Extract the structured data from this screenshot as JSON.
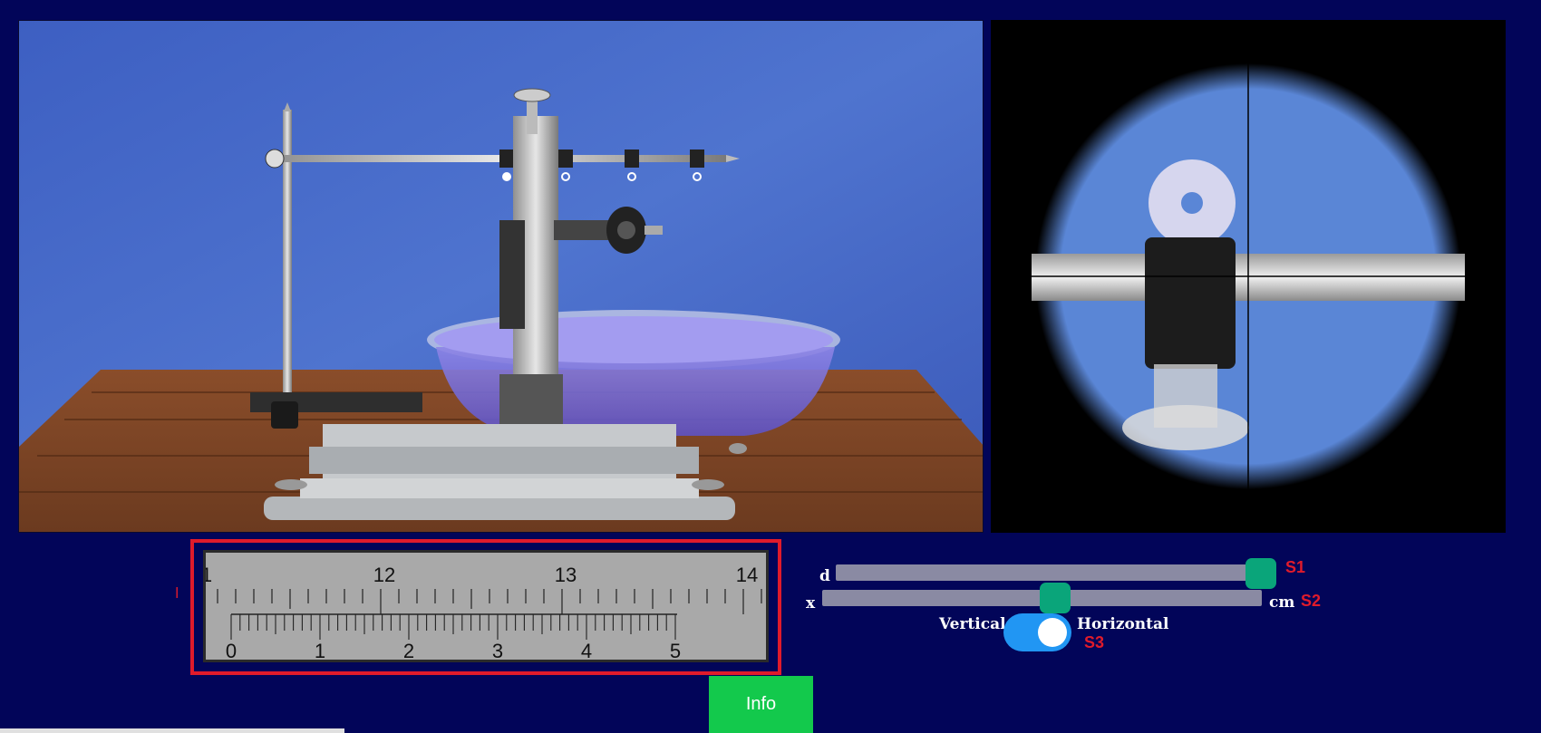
{
  "ruler": {
    "side_label": "l",
    "main_scale_labels": [
      "1",
      "12",
      "13",
      "14"
    ],
    "vernier_labels": [
      "0",
      "1",
      "2",
      "3",
      "4",
      "5"
    ]
  },
  "controls": {
    "d_label": "d",
    "x_label": "x",
    "unit_label": "cm",
    "s1_tag": "S1",
    "s2_tag": "S2",
    "s3_tag": "S3",
    "d_slider_fraction": 0.98,
    "x_slider_fraction": 0.53,
    "toggle_left_label": "Vertical",
    "toggle_right_label": "Horizontal",
    "toggle_state": "Horizontal"
  },
  "info_button": {
    "label": "Info"
  },
  "colors": {
    "page_bg": "#020559",
    "ruler_border": "#e01b2b",
    "slider_thumb": "#0aa57a",
    "toggle_on": "#2196f3",
    "info_button": "#13c94c"
  }
}
